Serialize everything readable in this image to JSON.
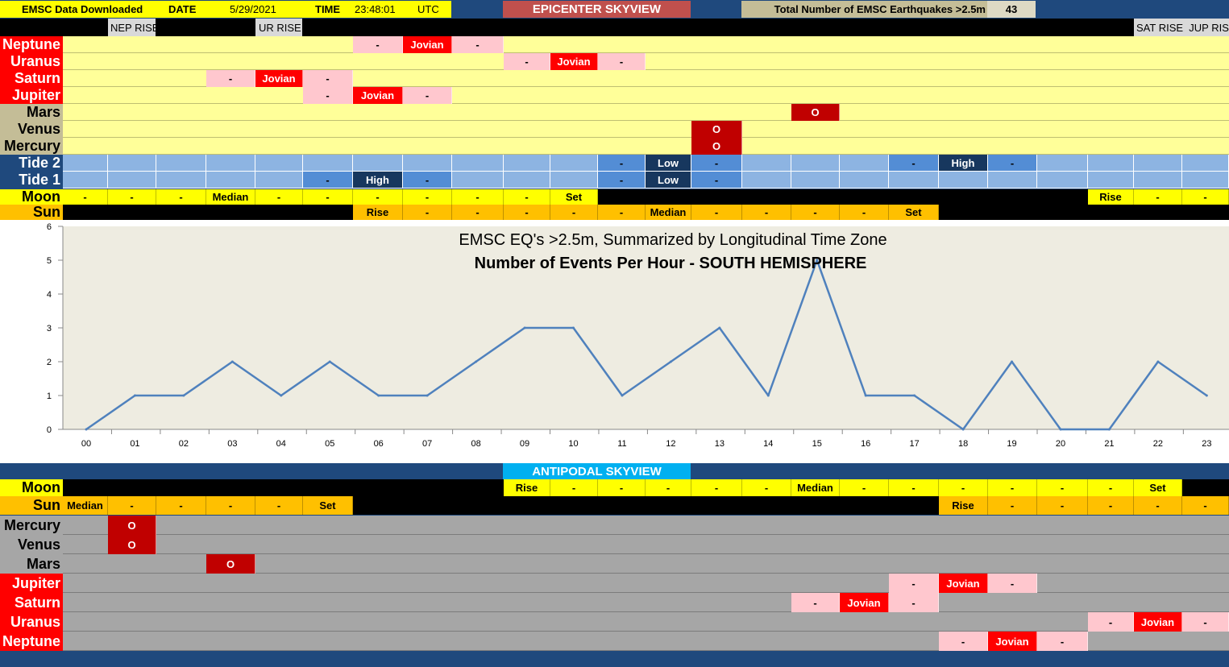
{
  "header": {
    "downloaded": "EMSC Data Downloaded",
    "date_label": "DATE",
    "date": "5/29/2021",
    "time_label": "TIME",
    "time": "23:48:01",
    "tz": "UTC",
    "title": "EPICENTER SKYVIEW",
    "total_label": "Total Number of EMSC Earthquakes >2.5m",
    "total": "43"
  },
  "rise_labels": {
    "nep": "NEP RISE",
    "ur": "UR RISE",
    "sat_jup": "SAT RISE  JUP RISE"
  },
  "colors": {
    "pale_yellow": "#ffff99",
    "pink": "#ffc7ce",
    "red": "#ff0000",
    "dark_red": "#c00000",
    "tide_light": "#8db4e2",
    "tide_mid": "#538dd5",
    "tide_dark": "#17375e",
    "yellow": "#ffff00",
    "orange": "#ffc000",
    "gray": "#a6a6a6",
    "antipodal_blue": "#00b0f0",
    "line": "#4f81bd",
    "plot_bg": "#eeece1"
  },
  "epicenter_rows": [
    {
      "label": "Neptune",
      "label_style": "red",
      "bg": "pale",
      "cells": {
        "6": [
          "-",
          "pink"
        ],
        "7": [
          "Jovian",
          "red"
        ],
        "8": [
          "-",
          "pink"
        ]
      }
    },
    {
      "label": "Uranus",
      "label_style": "red",
      "bg": "pale",
      "cells": {
        "9": [
          "-",
          "pink"
        ],
        "10": [
          "Jovian",
          "red"
        ],
        "11": [
          "-",
          "pink"
        ]
      }
    },
    {
      "label": "Saturn",
      "label_style": "red",
      "bg": "pale",
      "cells": {
        "3": [
          "-",
          "pink"
        ],
        "4": [
          "Jovian",
          "red"
        ],
        "5": [
          "-",
          "pink"
        ]
      }
    },
    {
      "label": "Jupiter",
      "label_style": "red",
      "bg": "pale",
      "cells": {
        "5": [
          "-",
          "pink"
        ],
        "6": [
          "Jovian",
          "red"
        ],
        "7": [
          "-",
          "pink"
        ]
      }
    },
    {
      "label": "Mars",
      "label_style": "tan",
      "bg": "pale",
      "cells": {
        "15": [
          "O",
          "darkred"
        ]
      }
    },
    {
      "label": "Venus",
      "label_style": "tan",
      "bg": "pale",
      "cells": {
        "13": [
          "O",
          "darkred"
        ]
      }
    },
    {
      "label": "Mercury",
      "label_style": "tan",
      "bg": "pale",
      "cells": {
        "13": [
          "O",
          "darkred"
        ]
      }
    }
  ],
  "tide": {
    "tide2_label": "Tide 2",
    "tide1_label": "Tide 1",
    "tide2": {
      "11": [
        "-",
        "mid"
      ],
      "12": [
        "Low",
        "dark"
      ],
      "13": [
        "-",
        "mid"
      ],
      "17": [
        "-",
        "mid"
      ],
      "18": [
        "High",
        "dark"
      ],
      "19": [
        "-",
        "mid"
      ]
    },
    "tide1": {
      "5": [
        "-",
        "mid"
      ],
      "6": [
        "High",
        "dark"
      ],
      "7": [
        "-",
        "mid"
      ],
      "11": [
        "-",
        "mid"
      ],
      "12": [
        "Low",
        "dark"
      ],
      "13": [
        "-",
        "mid"
      ]
    }
  },
  "epicenter_moon": {
    "label": "Moon",
    "cells": [
      "-",
      "-",
      "-",
      "Median",
      "-",
      "-",
      "-",
      "-",
      "-",
      "-",
      "Set",
      "",
      "",
      "",
      "",
      "",
      "",
      "",
      "",
      "",
      "",
      "Rise",
      "-",
      "-"
    ]
  },
  "epicenter_sun": {
    "label": "Sun",
    "cells": [
      "",
      "",
      "",
      "",
      "",
      "",
      "Rise",
      "-",
      "-",
      "-",
      "-",
      "-",
      "Median",
      "-",
      "-",
      "-",
      "-",
      "Set",
      "",
      "",
      "",
      "",
      "",
      ""
    ]
  },
  "antipodal": {
    "title": "ANTIPODAL SKYVIEW",
    "moon": {
      "label": "Moon",
      "cells": [
        "",
        "",
        "",
        "",
        "",
        "",
        "",
        "",
        "",
        "Rise",
        "-",
        "-",
        "-",
        "-",
        "-",
        "Median",
        "-",
        "-",
        "-",
        "-",
        "-",
        "-",
        "Set",
        ""
      ]
    },
    "sun": {
      "label": "Sun",
      "cells": [
        "Median",
        "-",
        "-",
        "-",
        "-",
        "Set",
        "",
        "",
        "",
        "",
        "",
        "",
        "",
        "",
        "",
        "",
        "",
        "",
        "Rise",
        "-",
        "-",
        "-",
        "-",
        "-"
      ]
    },
    "rows": [
      {
        "label": "Mercury",
        "label_style": "gray",
        "cells": {
          "1": [
            "O",
            "darkred"
          ]
        }
      },
      {
        "label": "Venus",
        "label_style": "gray",
        "cells": {
          "1": [
            "O",
            "darkred"
          ]
        }
      },
      {
        "label": "Mars",
        "label_style": "gray",
        "cells": {
          "3": [
            "O",
            "darkred"
          ]
        }
      },
      {
        "label": "Jupiter",
        "label_style": "red",
        "cells": {
          "17": [
            "-",
            "pink"
          ],
          "18": [
            "Jovian",
            "red"
          ],
          "19": [
            "-",
            "pink"
          ]
        }
      },
      {
        "label": "Saturn",
        "label_style": "red",
        "cells": {
          "15": [
            "-",
            "pink"
          ],
          "16": [
            "Jovian",
            "red"
          ],
          "17": [
            "-",
            "pink"
          ]
        }
      },
      {
        "label": "Uranus",
        "label_style": "red",
        "cells": {
          "21": [
            "-",
            "pink"
          ],
          "22": [
            "Jovian",
            "red"
          ],
          "23": [
            "-",
            "pink"
          ]
        }
      },
      {
        "label": "Neptune",
        "label_style": "red",
        "cells": {
          "18": [
            "-",
            "pink"
          ],
          "19": [
            "Jovian",
            "red"
          ],
          "20": [
            "-",
            "pink"
          ]
        }
      }
    ]
  },
  "chart_data": {
    "type": "line",
    "title": "EMSC EQ's >2.5m, Summarized by Longitudinal Time Zone",
    "subtitle": "Number of Events Per Hour - SOUTH HEMISPHERE",
    "categories": [
      "00",
      "01",
      "02",
      "03",
      "04",
      "05",
      "06",
      "07",
      "08",
      "09",
      "10",
      "11",
      "12",
      "13",
      "14",
      "15",
      "16",
      "17",
      "18",
      "19",
      "20",
      "21",
      "22",
      "23"
    ],
    "values": [
      0,
      1,
      1,
      2,
      1,
      2,
      1,
      1,
      2,
      3,
      3,
      1,
      2,
      3,
      1,
      5,
      1,
      1,
      0,
      2,
      0,
      0,
      2,
      1
    ],
    "ylim": [
      0,
      6
    ],
    "yticks": [
      "0",
      "1",
      "2",
      "3",
      "4",
      "5",
      "6"
    ],
    "grid": false,
    "legend": "none"
  }
}
